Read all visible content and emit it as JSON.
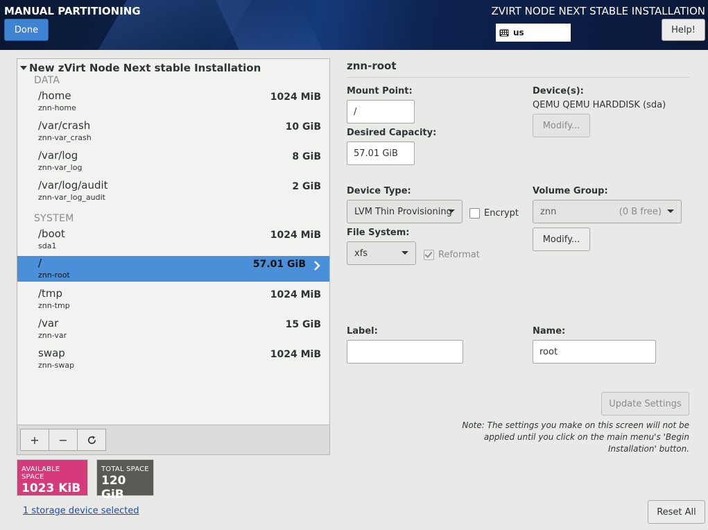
{
  "header": {
    "title": "MANUAL PARTITIONING",
    "product": "ZVIRT NODE NEXT STABLE INSTALLATION",
    "done_label": "Done",
    "keyboard_layout": "us",
    "help_label": "Help!"
  },
  "tree": {
    "root_label": "New zVirt Node Next stable Installation",
    "groups": [
      {
        "name": "DATA",
        "mounts": [
          {
            "mount": "/home",
            "device": "znn-home",
            "size": "1024 MiB"
          },
          {
            "mount": "/var/crash",
            "device": "znn-var_crash",
            "size": "10 GiB"
          },
          {
            "mount": "/var/log",
            "device": "znn-var_log",
            "size": "8 GiB"
          },
          {
            "mount": "/var/log/audit",
            "device": "znn-var_log_audit",
            "size": "2 GiB"
          }
        ]
      },
      {
        "name": "SYSTEM",
        "mounts": [
          {
            "mount": "/boot",
            "device": "sda1",
            "size": "1024 MiB"
          },
          {
            "mount": "/",
            "device": "znn-root",
            "size": "57.01 GiB",
            "selected": true
          },
          {
            "mount": "/tmp",
            "device": "znn-tmp",
            "size": "1024 MiB"
          },
          {
            "mount": "/var",
            "device": "znn-var",
            "size": "15 GiB"
          },
          {
            "mount": "swap",
            "device": "znn-swap",
            "size": "1024 MiB"
          }
        ]
      }
    ],
    "toolbar": {
      "add": "+",
      "remove": "−",
      "refresh": "refresh-icon"
    }
  },
  "space": {
    "available_label": "AVAILABLE SPACE",
    "available_value": "1023 KiB",
    "total_label": "TOTAL SPACE",
    "total_value": "120 GiB",
    "available_color": "#d63a7a",
    "total_color": "#5a5a55"
  },
  "storage_link": "1 storage device selected",
  "detail": {
    "title": "znn-root",
    "mount_point_label": "Mount Point:",
    "mount_point_value": "/",
    "desired_capacity_label": "Desired Capacity:",
    "desired_capacity_value": "57.01 GiB",
    "devices_label": "Device(s):",
    "devices_value": "QEMU QEMU HARDDISK (sda)",
    "devices_modify": "Modify...",
    "device_type_label": "Device Type:",
    "device_type_value": "LVM Thin Provisioning",
    "encrypt_label": "Encrypt",
    "file_system_label": "File System:",
    "file_system_value": "xfs",
    "reformat_label": "Reformat",
    "volume_group_label": "Volume Group:",
    "volume_group_value": "znn",
    "volume_group_free": "(0 B free)",
    "volume_group_modify": "Modify...",
    "label_label": "Label:",
    "label_value": "",
    "name_label": "Name:",
    "name_value": "root",
    "update_settings": "Update Settings",
    "note": "Note:  The settings you make on this screen will not be applied until you click on the main menu's 'Begin Installation' button."
  },
  "reset_all": "Reset All",
  "accent_color": "#4a90d9"
}
